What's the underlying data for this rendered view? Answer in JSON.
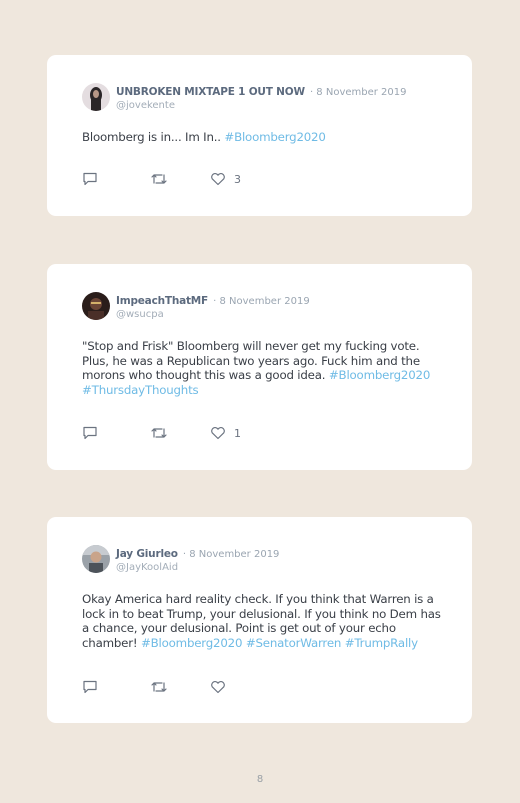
{
  "tweets": [
    {
      "name": "UNBROKEN MIXTAPE 1 OUT NOW",
      "date": "· 8 November 2019",
      "handle": "@jovekente",
      "text": "Bloomberg is in... Im In.. ",
      "hashtags": [
        "#Bloomberg2020"
      ],
      "likes": "3",
      "avatar_color": "#c9c0c4"
    },
    {
      "name": "ImpeachThatMF",
      "date": "· 8 November 2019",
      "handle": "@wsucpa",
      "text": "\"Stop and Frisk\" Bloomberg will never get my fucking vote. Plus, he was a Republican two years ago. Fuck him and the morons who thought this was a good idea. ",
      "hashtags": [
        "#Bloomberg2020",
        "#ThursdayThoughts"
      ],
      "likes": "1",
      "avatar_color": "#3a2a26"
    },
    {
      "name": "Jay Giurleo",
      "date": "· 8 November 2019",
      "handle": "@JayKoolAid",
      "text": "Okay America hard reality check. If you think that Warren is a lock in to beat Trump, your delusional. If you think no Dem has a chance, your delusional. Point is get out of your echo chamber! ",
      "hashtags": [
        "#Bloomberg2020",
        "#SenatorWarren",
        "#TrumpRally"
      ],
      "likes": "",
      "avatar_color": "#7b8088"
    }
  ],
  "page_number": "8",
  "colors": {
    "background": "#efe7dd",
    "hashtag": "#6fbbe5",
    "icon": "#6b7380"
  },
  "icons": [
    "comment-icon",
    "retweet-icon",
    "heart-icon"
  ]
}
